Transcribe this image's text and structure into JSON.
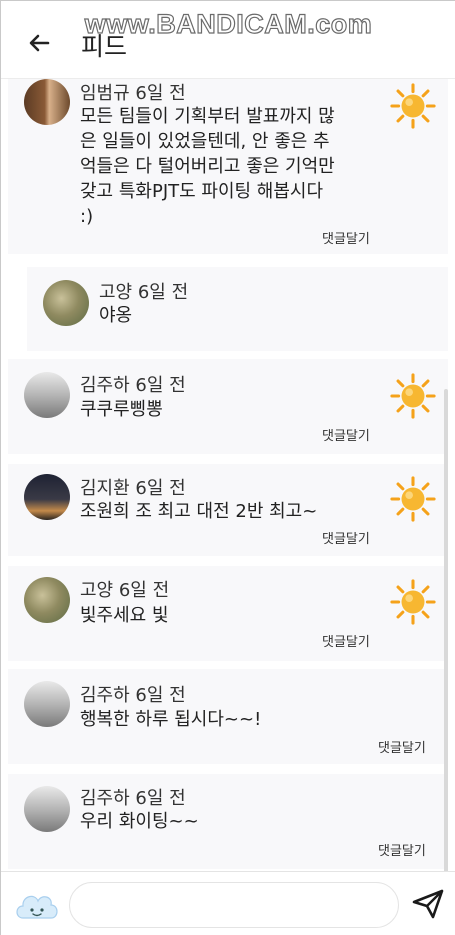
{
  "watermark": "www.BANDICAM.com",
  "header": {
    "title": "피드"
  },
  "comments": [
    {
      "name": "임범규",
      "time": "6일 전",
      "lines": [
        "모든 팀들이 기획부터 발표까지 많",
        "은 일들이 있었을텐데, 안 좋은 추",
        "억들은 다 털어버리고 좋은 기억만",
        "갖고 특화PJT도 파이팅 해봅시다",
        ":)"
      ],
      "reply": "댓글달기",
      "avatar": "wood-icon"
    },
    {
      "name": "고양",
      "time": "6일 전",
      "lines": [
        "야옹"
      ],
      "reply": "",
      "avatar": "cat-icon"
    },
    {
      "name": "김주하",
      "time": "6일 전",
      "lines": [
        "쿠쿠루삥뽕"
      ],
      "reply": "댓글달기",
      "avatar": "bw-photo-icon"
    },
    {
      "name": "김지환",
      "time": "6일 전",
      "lines": [
        "조원희 조 최고 대전 2반 최고~"
      ],
      "reply": "댓글달기",
      "avatar": "night-city-icon"
    },
    {
      "name": "고양",
      "time": "6일 전",
      "lines": [
        "빛주세요 빛"
      ],
      "reply": "댓글달기",
      "avatar": "cat-icon"
    },
    {
      "name": "김주하",
      "time": "6일 전",
      "lines": [
        "행복한 하루 됩시다~~!"
      ],
      "reply": "댓글달기",
      "avatar": "bw-photo-icon"
    },
    {
      "name": "김주하",
      "time": "6일 전",
      "lines": [
        "우리 화이팅~~"
      ],
      "reply": "댓글달기",
      "avatar": "bw-photo-icon"
    }
  ],
  "input": {
    "placeholder": "",
    "value": ""
  },
  "icons": {
    "back": "back-arrow-icon",
    "sun": "sun-icon",
    "emoji": "cloud-face-icon",
    "send": "send-icon"
  },
  "colors": {
    "card": "#f8f8fa",
    "sun_ray": "#f5a21a",
    "sun_core": "#f7b731"
  }
}
